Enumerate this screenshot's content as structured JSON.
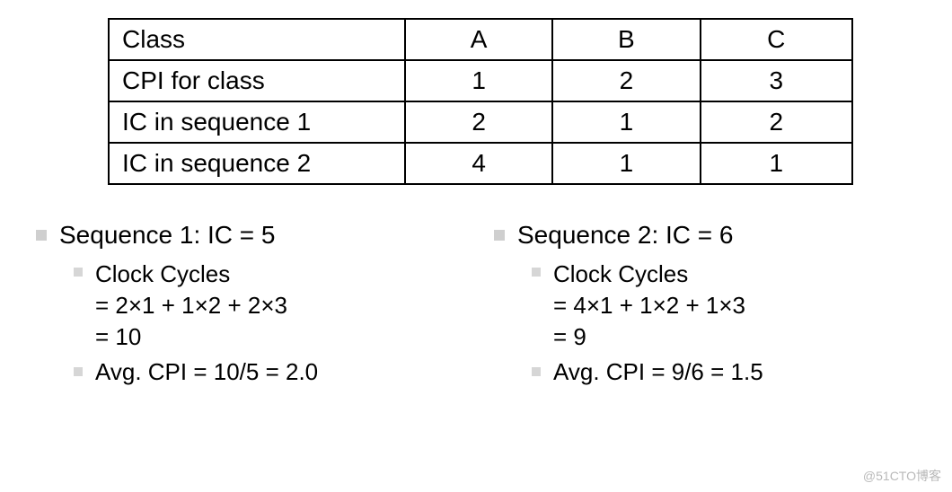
{
  "chart_data": {
    "type": "table",
    "columns": [
      "Class",
      "A",
      "B",
      "C"
    ],
    "rows": [
      [
        "CPI for class",
        1,
        2,
        3
      ],
      [
        "IC in sequence 1",
        2,
        1,
        2
      ],
      [
        "IC in sequence 2",
        4,
        1,
        1
      ]
    ]
  },
  "table": {
    "header": {
      "c0": "Class",
      "c1": "A",
      "c2": "B",
      "c3": "C"
    },
    "r1": {
      "c0": "CPI for class",
      "c1": "1",
      "c2": "2",
      "c3": "3"
    },
    "r2": {
      "c0": "IC in sequence 1",
      "c1": "2",
      "c2": "1",
      "c3": "2"
    },
    "r3": {
      "c0": "IC in sequence 2",
      "c1": "4",
      "c2": "1",
      "c3": "1"
    }
  },
  "left": {
    "title": "Sequence 1: IC = 5",
    "cc_label": "Clock Cycles",
    "cc_expr": "= 2×1 + 1×2 + 2×3",
    "cc_result": "= 10",
    "avg": "Avg. CPI = 10/5 = 2.0"
  },
  "right": {
    "title": "Sequence 2: IC = 6",
    "cc_label": "Clock Cycles",
    "cc_expr": "= 4×1 + 1×2 + 1×3",
    "cc_result": "= 9",
    "avg": "Avg. CPI = 9/6 = 1.5"
  },
  "watermark": "@51CTO博客"
}
